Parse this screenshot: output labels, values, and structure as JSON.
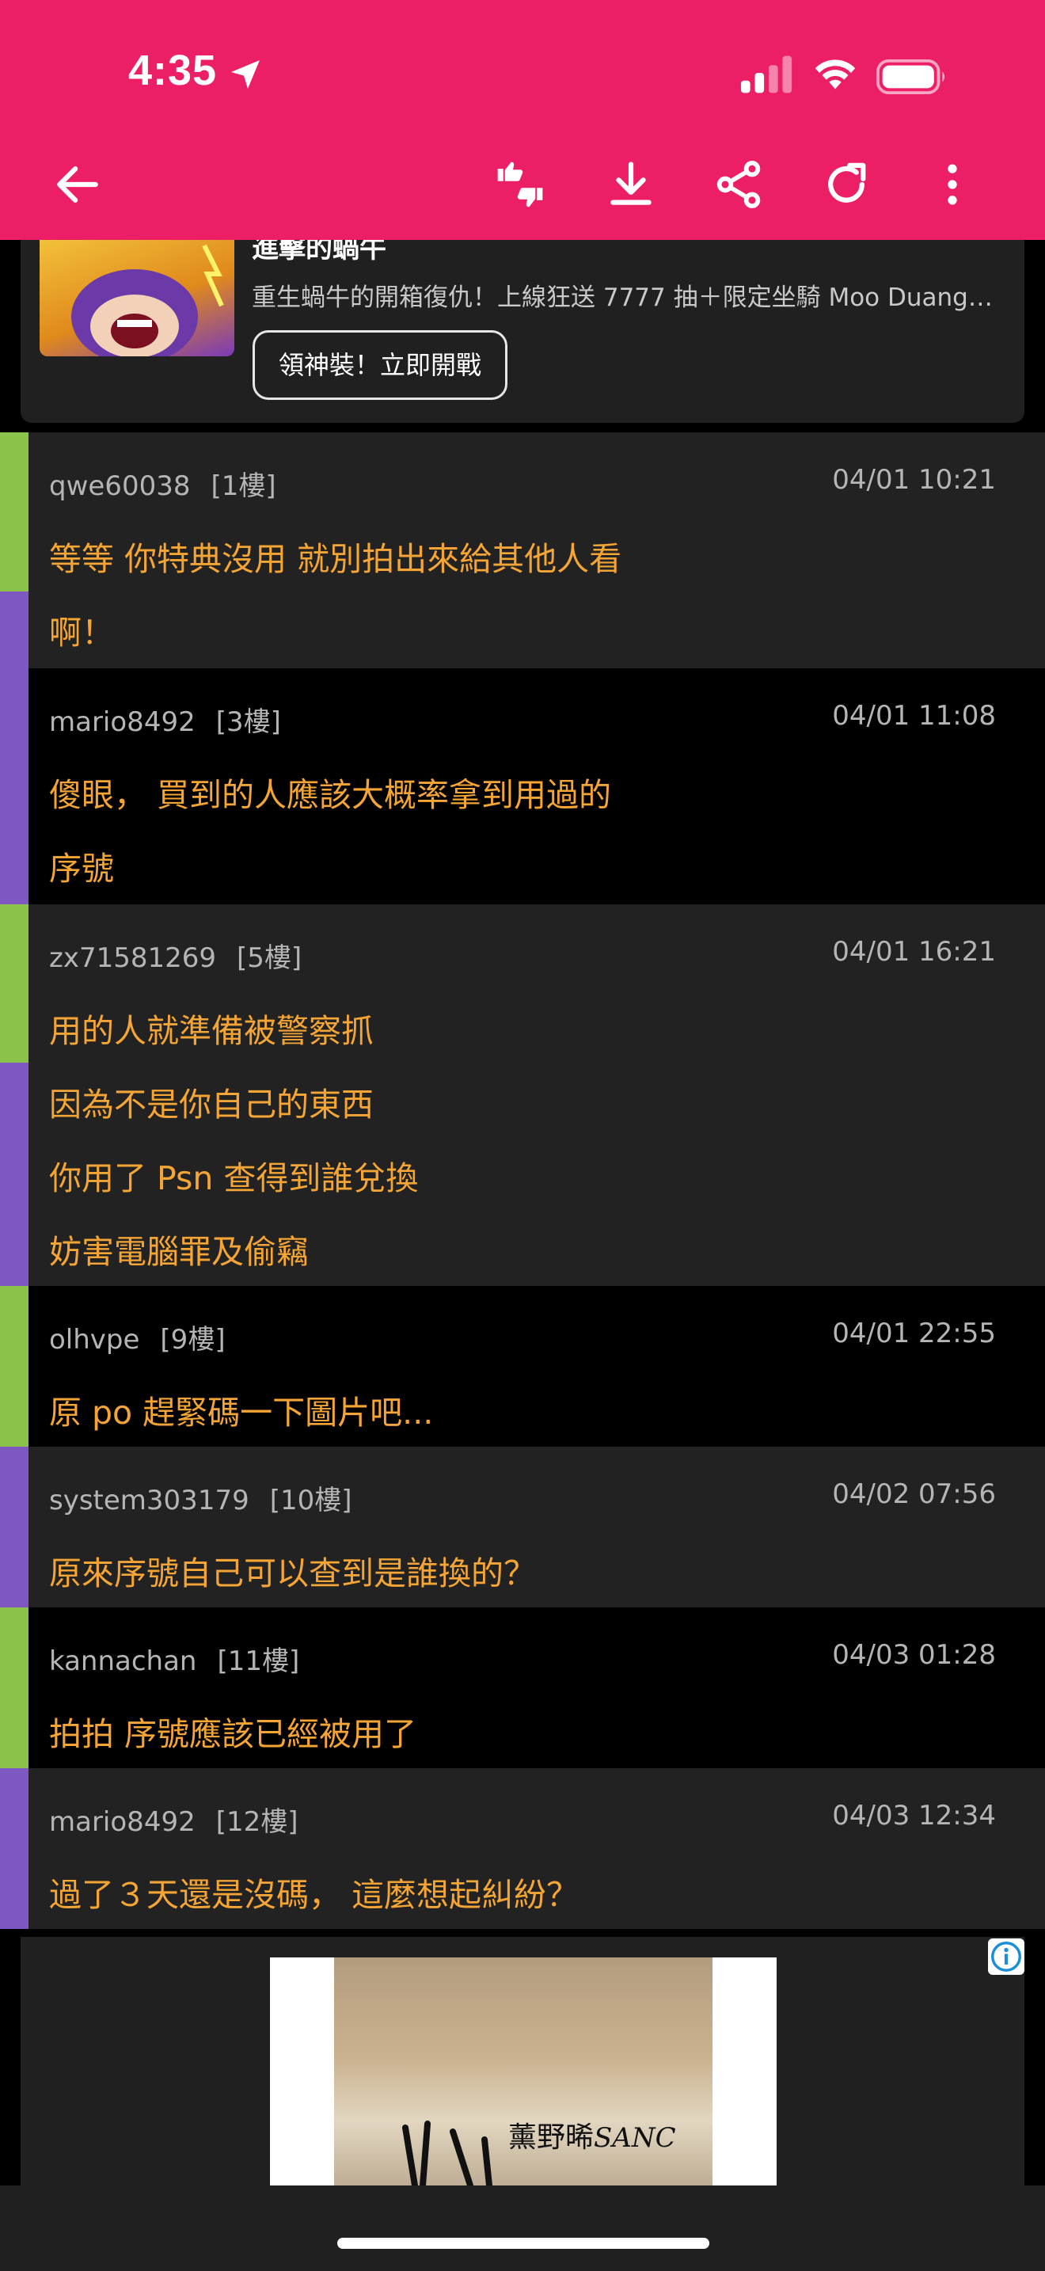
{
  "status_bar": {
    "time": "4:35",
    "icons": [
      "location-arrow-icon",
      "cellular-signal-icon",
      "wifi-icon",
      "battery-icon"
    ]
  },
  "toolbar": {
    "background": "#EC1F66",
    "icons": [
      "back-arrow-icon",
      "thumbs-up-down-icon",
      "download-icon",
      "share-icon",
      "refresh-icon",
      "more-vertical-icon"
    ]
  },
  "ad_card": {
    "title": "進擊的蝸牛",
    "description": "重生蝸牛的開箱復仇！上線狂送 7777 抽＋限定坐騎 Moo Duang…",
    "cta": "領神裝！立即開戰"
  },
  "colors": {
    "reply_text": "#F4A535",
    "accent_green": "#8BC34A",
    "accent_purple": "#7E57C2",
    "meta_text": "#B5B5B5"
  },
  "replies": [
    {
      "user": "qwe60038",
      "floor": "[1樓]",
      "time": "04/01 10:21",
      "lines": [
        "等等 你特典沒用 就別拍出來給其他人看",
        "啊！"
      ]
    },
    {
      "user": "mario8492",
      "floor": "[3樓]",
      "time": "04/01 11:08",
      "lines": [
        "傻眼，  買到的人應該大概率拿到用過的",
        "序號"
      ]
    },
    {
      "user": "zx71581269",
      "floor": "[5樓]",
      "time": "04/01 16:21",
      "lines": [
        "用的人就準備被警察抓",
        "因為不是你自己的東西",
        "你用了 Psn 查得到誰兌換",
        "妨害電腦罪及偷竊"
      ]
    },
    {
      "user": "olhvpe",
      "floor": "[9樓]",
      "time": "04/01 22:55",
      "lines": [
        "原 po 趕緊碼一下圖片吧..."
      ]
    },
    {
      "user": "system303179",
      "floor": "[10樓]",
      "time": "04/02 07:56",
      "lines": [
        "原來序號自己可以查到是誰換的？"
      ]
    },
    {
      "user": "kannachan",
      "floor": "[11樓]",
      "time": "04/03 01:28",
      "lines": [
        "拍拍 序號應該已經被用了"
      ]
    },
    {
      "user": "mario8492",
      "floor": "[12樓]",
      "time": "04/03 12:34",
      "lines": [
        "過了３天還是沒碼，  這麼想起糾紛？"
      ]
    }
  ],
  "bottom_ad": {
    "photo_text": "薰野晞",
    "photo_text_latin": "SANC",
    "badge_icon": "info-icon"
  }
}
